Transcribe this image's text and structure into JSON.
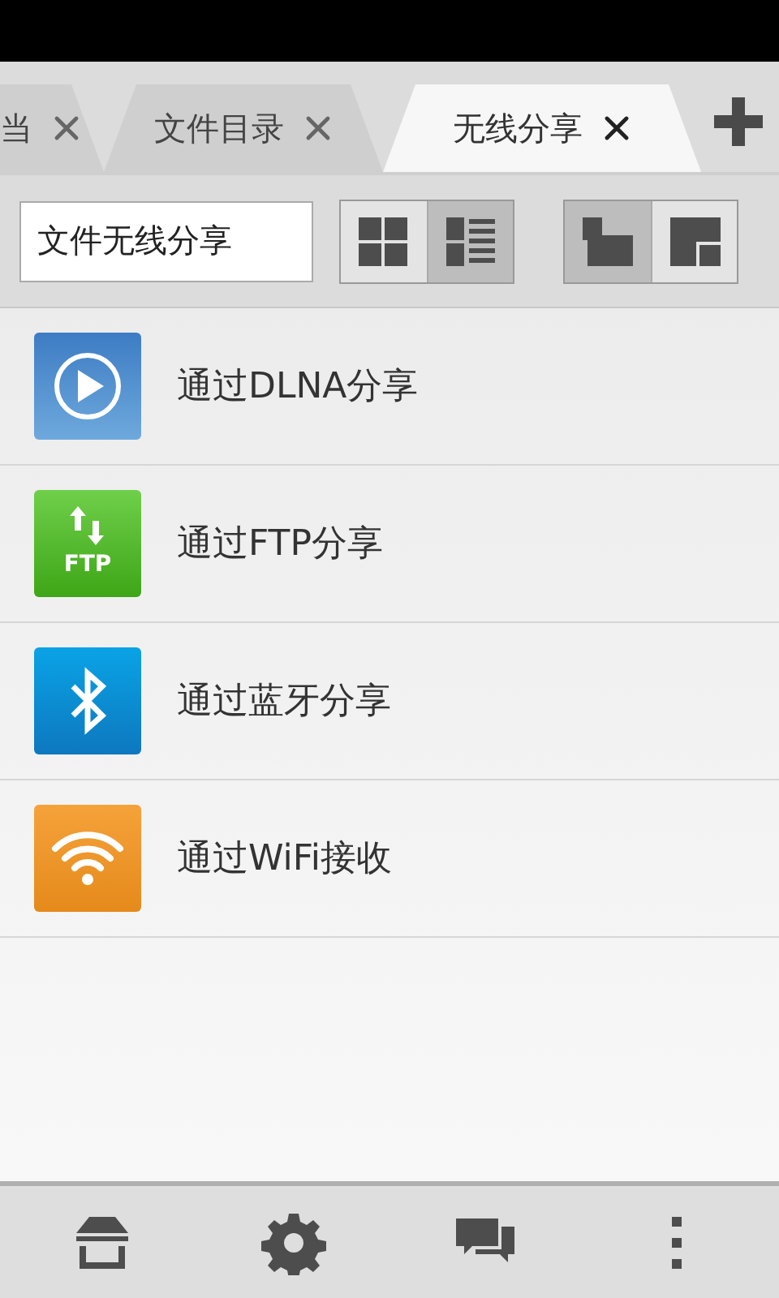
{
  "tabs": [
    {
      "label": "当",
      "selected": false
    },
    {
      "label": "文件目录",
      "selected": false
    },
    {
      "label": "无线分享",
      "selected": true
    }
  ],
  "toolbar": {
    "title_field": "文件无线分享",
    "view_modes": [
      {
        "kind": "grid",
        "selected": false
      },
      {
        "kind": "list",
        "selected": true
      }
    ],
    "layout_modes": [
      {
        "kind": "corner-bottom",
        "selected": true
      },
      {
        "kind": "corner-top",
        "selected": false
      }
    ]
  },
  "share_items": [
    {
      "kind": "dlna",
      "label": "通过DLNA分享"
    },
    {
      "kind": "ftp",
      "label": "通过FTP分享",
      "icon_text": "FTP"
    },
    {
      "kind": "bluetooth",
      "label": "通过蓝牙分享"
    },
    {
      "kind": "wifi",
      "label": "通过WiFi接收"
    }
  ],
  "bottom_bar": [
    {
      "kind": "store"
    },
    {
      "kind": "settings"
    },
    {
      "kind": "chat"
    },
    {
      "kind": "more"
    }
  ]
}
